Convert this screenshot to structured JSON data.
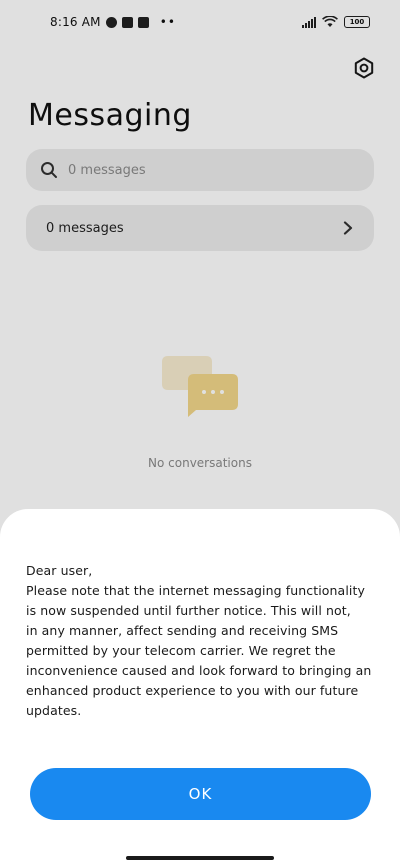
{
  "status_bar": {
    "time": "8:16 AM",
    "dots": "••",
    "battery_level": "100",
    "icons": [
      "alarm-icon",
      "app-notification-icon",
      "square-notification-icon",
      "upload-icon",
      "signal-icon",
      "wifi-icon",
      "battery-icon"
    ]
  },
  "header": {
    "title": "Messaging",
    "settings_icon": "gear-icon"
  },
  "search": {
    "placeholder": "0 messages"
  },
  "messages_row": {
    "label": "0 messages",
    "chevron_icon": "chevron-right-icon"
  },
  "empty_state": {
    "icon": "conversation-bubbles-icon",
    "text": "No conversations"
  },
  "dialog": {
    "lines": [
      "Dear user,",
      "Please note that the internet messaging functionality",
      "is now suspended until further notice. This will not,",
      "in any manner, affect sending and receiving SMS",
      "permitted by your telecom carrier. We regret the",
      "inconvenience caused and look forward to bringing an",
      "enhanced product experience to you with our future",
      "updates."
    ],
    "ok_label": "OK"
  },
  "colors": {
    "accent": "#1989f0",
    "field_background": "#ececec",
    "empty_icon_yellow": "#f2d68a"
  }
}
